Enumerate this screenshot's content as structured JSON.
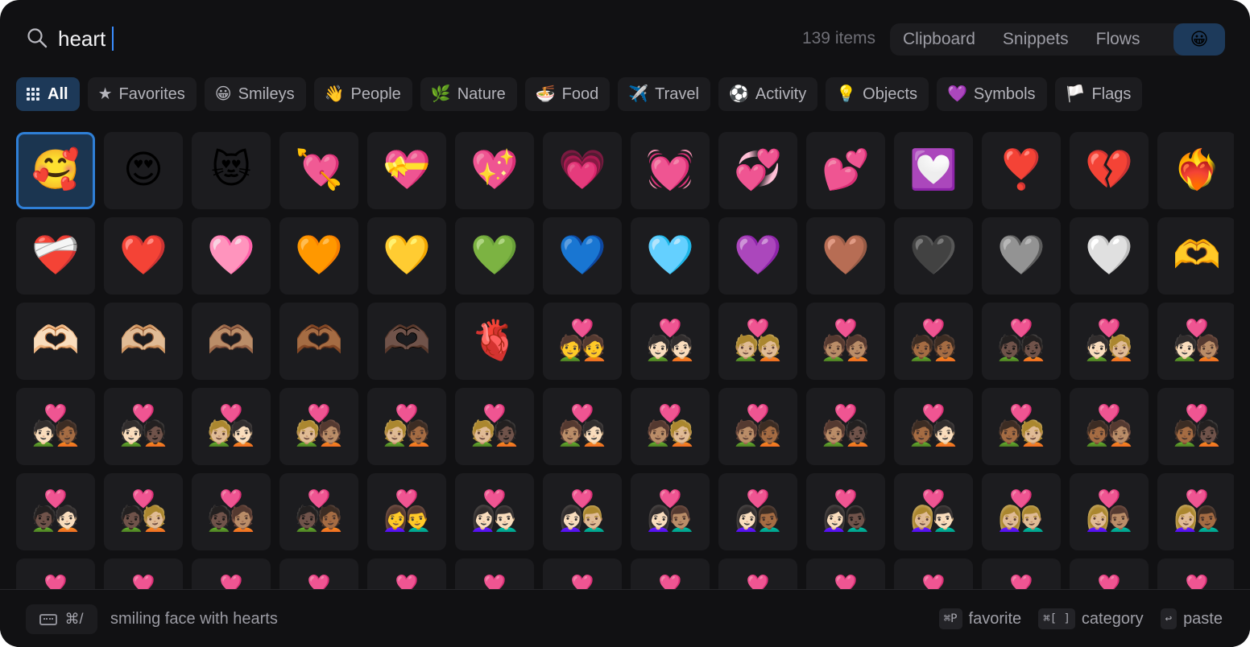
{
  "search": {
    "query": "heart",
    "placeholder": ""
  },
  "header": {
    "count": "139 items",
    "tabs": [
      "Clipboard",
      "Snippets",
      "Flows"
    ],
    "emoji_tab": "😀"
  },
  "categories": [
    {
      "icon": "",
      "label": "All",
      "active": true
    },
    {
      "icon": "★",
      "label": "Favorites"
    },
    {
      "icon": "😀",
      "label": "Smileys"
    },
    {
      "icon": "👋",
      "label": "People"
    },
    {
      "icon": "🌿",
      "label": "Nature"
    },
    {
      "icon": "🍜",
      "label": "Food"
    },
    {
      "icon": "✈️",
      "label": "Travel"
    },
    {
      "icon": "⚽",
      "label": "Activity"
    },
    {
      "icon": "💡",
      "label": "Objects"
    },
    {
      "icon": "💜",
      "label": "Symbols"
    },
    {
      "icon": "🏳️",
      "label": "Flags"
    }
  ],
  "emojis": [
    "🥰",
    "😍",
    "😻",
    "💘",
    "💝",
    "💖",
    "💗",
    "💓",
    "💞",
    "💕",
    "💟",
    "❣️",
    "💔",
    "❤️‍🔥",
    "❤️‍🩹",
    "❤️",
    "🩷",
    "🧡",
    "💛",
    "💚",
    "💙",
    "🩵",
    "💜",
    "🤎",
    "🖤",
    "🩶",
    "🤍",
    "🫶",
    "🫶🏻",
    "🫶🏼",
    "🫶🏽",
    "🫶🏾",
    "🫶🏿",
    "🫀",
    "💑",
    "💑🏻",
    "💑🏼",
    "💑🏽",
    "💑🏾",
    "💑🏿",
    "🧑🏻‍❤️‍🧑🏼",
    "🧑🏻‍❤️‍🧑🏽",
    "🧑🏻‍❤️‍🧑🏾",
    "🧑🏻‍❤️‍🧑🏿",
    "🧑🏼‍❤️‍🧑🏻",
    "🧑🏼‍❤️‍🧑🏽",
    "🧑🏼‍❤️‍🧑🏾",
    "🧑🏼‍❤️‍🧑🏿",
    "🧑🏽‍❤️‍🧑🏻",
    "🧑🏽‍❤️‍🧑🏼",
    "🧑🏽‍❤️‍🧑🏾",
    "🧑🏽‍❤️‍🧑🏿",
    "🧑🏾‍❤️‍🧑🏻",
    "🧑🏾‍❤️‍🧑🏼",
    "🧑🏾‍❤️‍🧑🏽",
    "🧑🏾‍❤️‍🧑🏿",
    "🧑🏿‍❤️‍🧑🏻",
    "🧑🏿‍❤️‍🧑🏼",
    "🧑🏿‍❤️‍🧑🏽",
    "🧑🏿‍❤️‍🧑🏾",
    "👩‍❤️‍👨",
    "👩🏻‍❤️‍👨🏻",
    "👩🏻‍❤️‍👨🏼",
    "👩🏻‍❤️‍👨🏽",
    "👩🏻‍❤️‍👨🏾",
    "👩🏻‍❤️‍👨🏿",
    "👩🏼‍❤️‍👨🏻",
    "👩🏼‍❤️‍👨🏼",
    "👩🏼‍❤️‍👨🏽",
    "👩🏼‍❤️‍👨🏾",
    "👩🏼‍❤️‍👨🏿",
    "👩🏽‍❤️‍👨🏻",
    "👩🏽‍❤️‍👨🏼",
    "👩🏽‍❤️‍👨🏽",
    "👩🏽‍❤️‍👨🏾",
    "👩🏽‍❤️‍👨🏿",
    "👩🏾‍❤️‍👨🏻",
    "👩🏾‍❤️‍👨🏼",
    "👩🏾‍❤️‍👨🏽",
    "👩🏾‍❤️‍👨🏾",
    "👩🏾‍❤️‍👨🏿",
    "👩🏿‍❤️‍👨🏻",
    "👩🏿‍❤️‍👨🏼",
    "👩🏿‍❤️‍👨🏽"
  ],
  "selected_index": 0,
  "footer": {
    "shortcut_label": "⌘/",
    "emoji_name": "smiling face with hearts",
    "hints": [
      {
        "key": "⌘P",
        "label": "favorite"
      },
      {
        "key": "⌘[ ]",
        "label": "category"
      },
      {
        "key": "↩",
        "label": "paste"
      }
    ]
  },
  "colors": {
    "background": "#111113",
    "surface": "#1c1c1f",
    "accent": "#2f7fd6",
    "active": "#1d3958"
  }
}
